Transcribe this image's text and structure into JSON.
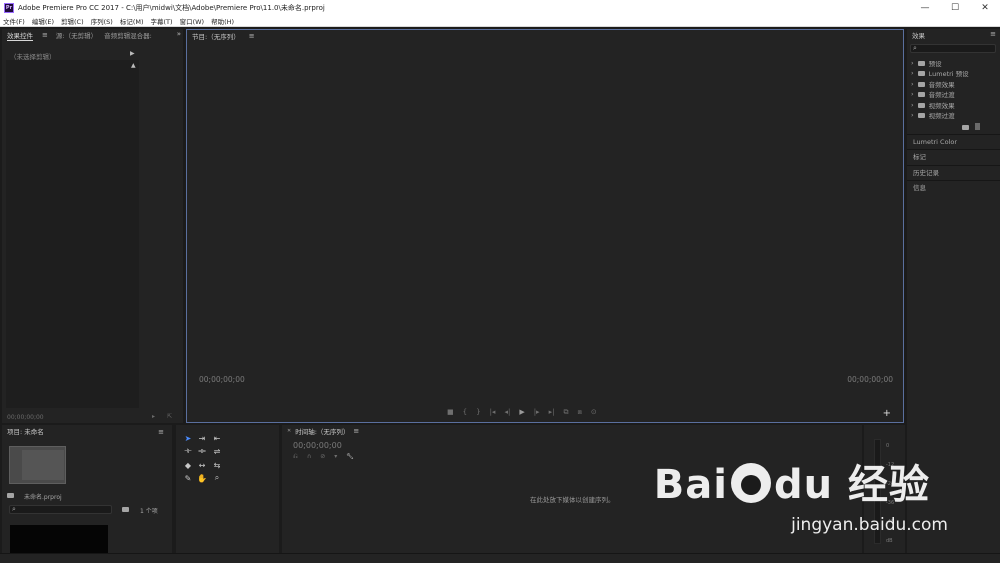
{
  "window": {
    "title": "Adobe Premiere Pro CC 2017 - C:\\用户\\midwi\\文档\\Adobe\\Premiere Pro\\11.0\\未命名.prproj",
    "logo_text": "Pr",
    "minimize": "—",
    "maximize": "☐",
    "close": "✕"
  },
  "menu": [
    "文件(F)",
    "编辑(E)",
    "剪辑(C)",
    "序列(S)",
    "标记(M)",
    "字幕(T)",
    "窗口(W)",
    "帮助(H)"
  ],
  "left_panel": {
    "tabs": [
      "效果控件",
      "源:（无剪辑）",
      "音频剪辑混合器:"
    ],
    "overflow": "»",
    "no_clip": "（未选择剪辑）",
    "timecode": "00;00;00;00"
  },
  "program": {
    "title": "节目:（无序列）",
    "tc_left": "00;00;00;00",
    "tc_right": "00;00;00;00",
    "transport": [
      "■",
      "{",
      "}",
      "|◂",
      "◂|",
      "▶",
      "|▸",
      "▸|",
      "⧉",
      "⧈",
      "⊙"
    ],
    "add": "+"
  },
  "effects": {
    "title": "效果",
    "tree": [
      "预设",
      "Lumetri 预设",
      "音频效果",
      "音频过渡",
      "视频效果",
      "视频过渡"
    ],
    "sections": [
      "Lumetri Color",
      "标记",
      "历史记录",
      "信息"
    ]
  },
  "project": {
    "title": "项目: 未命名",
    "file": "未命名.prproj",
    "count": "1 个项"
  },
  "timeline": {
    "title": "时间轴:（无序列）",
    "close": "✕",
    "timecode": "00;00;00;00",
    "drop_hint": "在此处放下媒体以创建序列。"
  },
  "meter": {
    "labels": [
      "0",
      "-12",
      "-24",
      "-36",
      "-48",
      "dB"
    ]
  },
  "watermark": {
    "brand": "Bai",
    "brand2": "du",
    "cn": "经验",
    "sub": "jingyan.baidu.com"
  }
}
